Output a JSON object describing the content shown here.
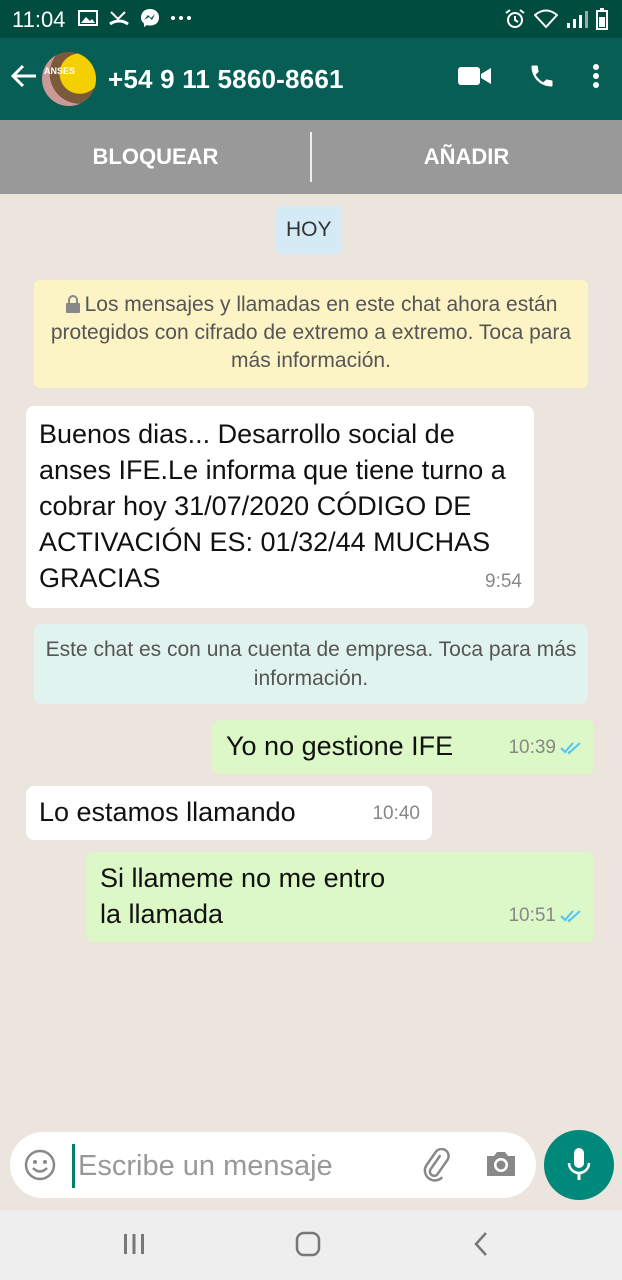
{
  "status_bar": {
    "time": "11:04",
    "left_icons": [
      "gallery-icon",
      "missed-call-icon",
      "messenger-icon",
      "more-icon"
    ],
    "right_icons": [
      "alarm-icon",
      "wifi-icon",
      "signal-icon",
      "battery-icon"
    ]
  },
  "header": {
    "contact": "+54 9 11 5860-8661",
    "avatar_text": "ANSES",
    "icons": [
      "back-arrow-icon",
      "video-call-icon",
      "phone-icon",
      "more-vert-icon"
    ]
  },
  "actions": {
    "block": "BLOQUEAR",
    "add": "AÑADIR"
  },
  "chat": {
    "day": "HOY",
    "encryption_notice": "Los mensajes y llamadas en este chat ahora están protegidos con cifrado de extremo a extremo. Toca para más información.",
    "business_notice": "Este chat es con una cuenta de empresa. Toca para más información.",
    "messages": [
      {
        "direction": "in",
        "text": "Buenos dias... Desarrollo social de anses IFE.Le informa que tiene turno a cobrar hoy  31/07/2020 CÓDIGO DE ACTIVACIÓN ES: 01/32/44 MUCHAS GRACIAS",
        "time": "9:54"
      },
      {
        "direction": "out",
        "text": "Yo no gestione IFE",
        "time": "10:39",
        "read": true
      },
      {
        "direction": "in",
        "text": "Lo estamos llamando",
        "time": "10:40"
      },
      {
        "direction": "out",
        "text": "Si llameme no me entro la llamada",
        "time": "10:51",
        "read": true
      }
    ]
  },
  "composer": {
    "placeholder": "Escribe un mensaje",
    "value": ""
  },
  "colors": {
    "status_bar": "#004d40",
    "app_bar": "#075e54",
    "action_bar": "#999999",
    "chat_bg": "#ece5dd",
    "incoming": "#ffffff",
    "outgoing": "#dcf8c6",
    "read_ticks": "#4fc3f7",
    "mic_button": "#00897b"
  }
}
